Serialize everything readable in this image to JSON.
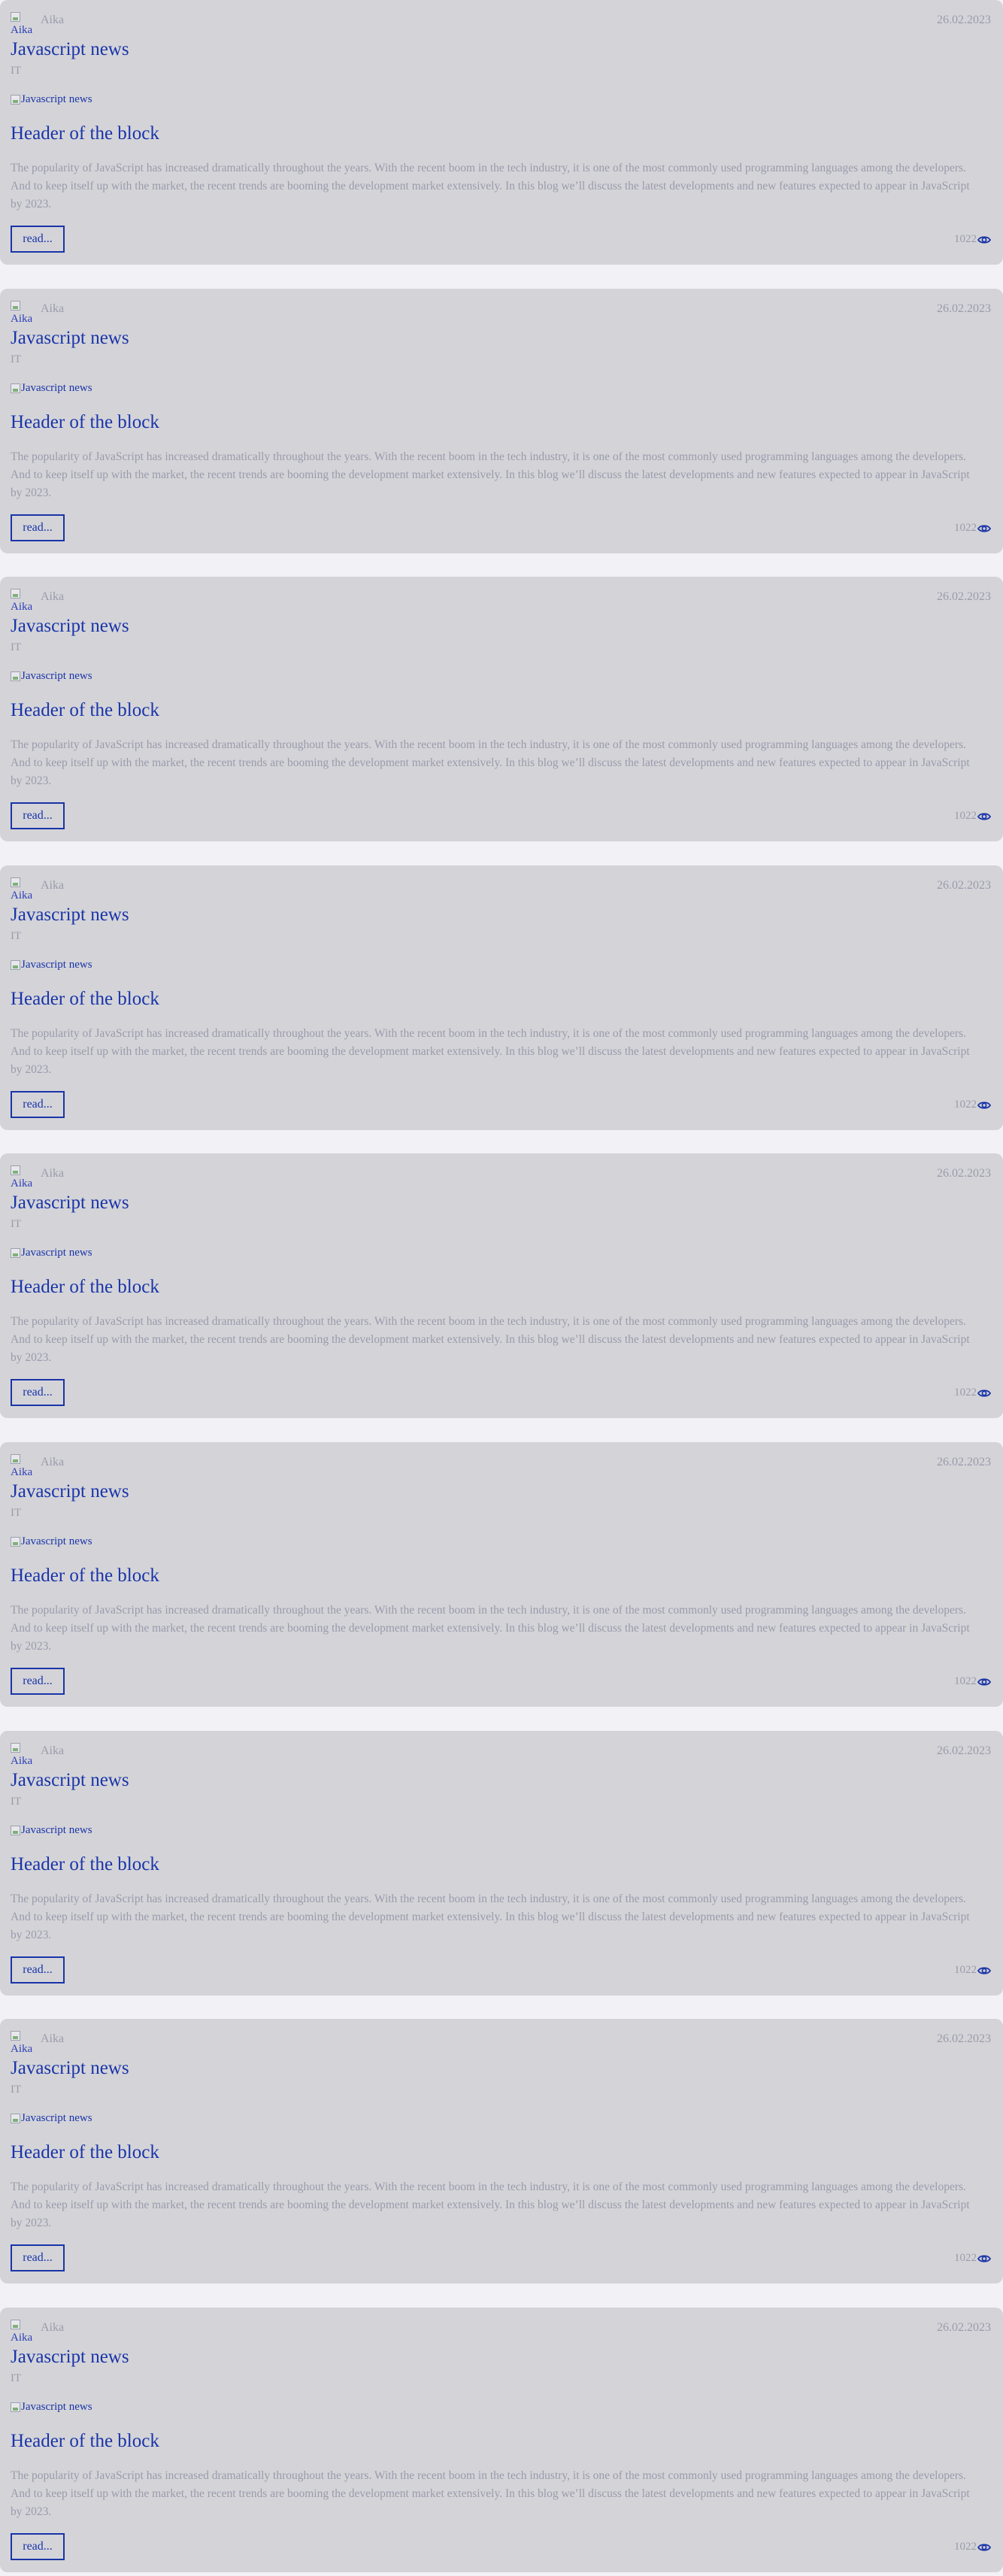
{
  "posts": [
    {
      "author": "Aika",
      "avatar_alt": "Aika",
      "date": "26.02.2023",
      "title": "Javascript news",
      "category": "IT",
      "image_alt": "Javascript news",
      "header": "Header of the block",
      "text": "The popularity of JavaScript has increased dramatically throughout the years. With the recent boom in the tech industry, it is one of the most commonly used programming languages among the developers. And to keep itself up with the market, the recent trends are booming the development market extensively. In this blog we’ll discuss the latest developments and new features expected to appear in JavaScript by 2023.",
      "read_label": "read...",
      "views": "1022"
    },
    {
      "author": "Aika",
      "avatar_alt": "Aika",
      "date": "26.02.2023",
      "title": "Javascript news",
      "category": "IT",
      "image_alt": "Javascript news",
      "header": "Header of the block",
      "text": "The popularity of JavaScript has increased dramatically throughout the years. With the recent boom in the tech industry, it is one of the most commonly used programming languages among the developers. And to keep itself up with the market, the recent trends are booming the development market extensively. In this blog we’ll discuss the latest developments and new features expected to appear in JavaScript by 2023.",
      "read_label": "read...",
      "views": "1022"
    },
    {
      "author": "Aika",
      "avatar_alt": "Aika",
      "date": "26.02.2023",
      "title": "Javascript news",
      "category": "IT",
      "image_alt": "Javascript news",
      "header": "Header of the block",
      "text": "The popularity of JavaScript has increased dramatically throughout the years. With the recent boom in the tech industry, it is one of the most commonly used programming languages among the developers. And to keep itself up with the market, the recent trends are booming the development market extensively. In this blog we’ll discuss the latest developments and new features expected to appear in JavaScript by 2023.",
      "read_label": "read...",
      "views": "1022"
    },
    {
      "author": "Aika",
      "avatar_alt": "Aika",
      "date": "26.02.2023",
      "title": "Javascript news",
      "category": "IT",
      "image_alt": "Javascript news",
      "header": "Header of the block",
      "text": "The popularity of JavaScript has increased dramatically throughout the years. With the recent boom in the tech industry, it is one of the most commonly used programming languages among the developers. And to keep itself up with the market, the recent trends are booming the development market extensively. In this blog we’ll discuss the latest developments and new features expected to appear in JavaScript by 2023.",
      "read_label": "read...",
      "views": "1022"
    },
    {
      "author": "Aika",
      "avatar_alt": "Aika",
      "date": "26.02.2023",
      "title": "Javascript news",
      "category": "IT",
      "image_alt": "Javascript news",
      "header": "Header of the block",
      "text": "The popularity of JavaScript has increased dramatically throughout the years. With the recent boom in the tech industry, it is one of the most commonly used programming languages among the developers. And to keep itself up with the market, the recent trends are booming the development market extensively. In this blog we’ll discuss the latest developments and new features expected to appear in JavaScript by 2023.",
      "read_label": "read...",
      "views": "1022"
    },
    {
      "author": "Aika",
      "avatar_alt": "Aika",
      "date": "26.02.2023",
      "title": "Javascript news",
      "category": "IT",
      "image_alt": "Javascript news",
      "header": "Header of the block",
      "text": "The popularity of JavaScript has increased dramatically throughout the years. With the recent boom in the tech industry, it is one of the most commonly used programming languages among the developers. And to keep itself up with the market, the recent trends are booming the development market extensively. In this blog we’ll discuss the latest developments and new features expected to appear in JavaScript by 2023.",
      "read_label": "read...",
      "views": "1022"
    },
    {
      "author": "Aika",
      "avatar_alt": "Aika",
      "date": "26.02.2023",
      "title": "Javascript news",
      "category": "IT",
      "image_alt": "Javascript news",
      "header": "Header of the block",
      "text": "The popularity of JavaScript has increased dramatically throughout the years. With the recent boom in the tech industry, it is one of the most commonly used programming languages among the developers. And to keep itself up with the market, the recent trends are booming the development market extensively. In this blog we’ll discuss the latest developments and new features expected to appear in JavaScript by 2023.",
      "read_label": "read...",
      "views": "1022"
    },
    {
      "author": "Aika",
      "avatar_alt": "Aika",
      "date": "26.02.2023",
      "title": "Javascript news",
      "category": "IT",
      "image_alt": "Javascript news",
      "header": "Header of the block",
      "text": "The popularity of JavaScript has increased dramatically throughout the years. With the recent boom in the tech industry, it is one of the most commonly used programming languages among the developers. And to keep itself up with the market, the recent trends are booming the development market extensively. In this blog we’ll discuss the latest developments and new features expected to appear in JavaScript by 2023.",
      "read_label": "read...",
      "views": "1022"
    },
    {
      "author": "Aika",
      "avatar_alt": "Aika",
      "date": "26.02.2023",
      "title": "Javascript news",
      "category": "IT",
      "image_alt": "Javascript news",
      "header": "Header of the block",
      "text": "The popularity of JavaScript has increased dramatically throughout the years. With the recent boom in the tech industry, it is one of the most commonly used programming languages among the developers. And to keep itself up with the market, the recent trends are booming the development market extensively. In this blog we’ll discuss the latest developments and new features expected to appear in JavaScript by 2023.",
      "read_label": "read...",
      "views": "1022"
    }
  ],
  "colors": {
    "accent": "#1a34a8",
    "muted_text": "#9a9aac",
    "card_background": "#d4d4d8",
    "page_background": "#f2f2f6"
  },
  "icons": {
    "views": "eye-icon",
    "avatar": "broken-image-icon",
    "news_image": "broken-image-icon"
  }
}
